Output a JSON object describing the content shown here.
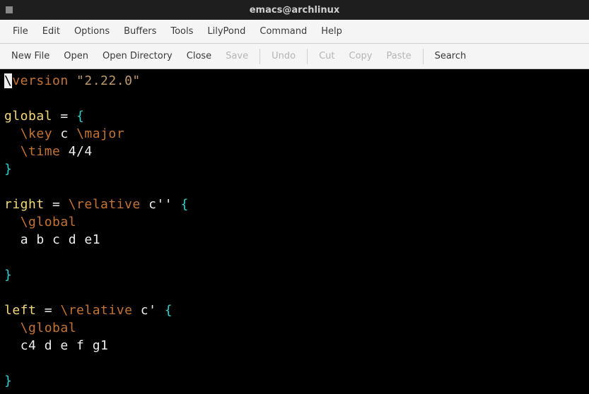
{
  "title": "emacs@archlinux",
  "menubar": [
    "File",
    "Edit",
    "Options",
    "Buffers",
    "Tools",
    "LilyPond",
    "Command",
    "Help"
  ],
  "toolbar": {
    "new_file": "New File",
    "open": "Open",
    "open_directory": "Open Directory",
    "close": "Close",
    "save": "Save",
    "undo": "Undo",
    "cut": "Cut",
    "copy": "Copy",
    "paste": "Paste",
    "search": "Search"
  },
  "code": {
    "l1_bs": "\\",
    "l1_cmd": "version",
    "l1_sp": " ",
    "l1_str": "\"2.22.0\"",
    "l3_var": "global",
    "l3_eq": " = ",
    "l3_brace": "{",
    "l4_ind": "  ",
    "l4_key": "\\key",
    "l4_args": " c ",
    "l4_major": "\\major",
    "l5_ind": "  ",
    "l5_time": "\\time",
    "l5_args": " 4/4",
    "l6_brace": "}",
    "l8_var": "right",
    "l8_eq": " = ",
    "l8_rel": "\\relative",
    "l8_args": " c'' ",
    "l8_brace": "{",
    "l9_ind": "  ",
    "l9_global": "\\global",
    "l10_ind": "  ",
    "l10_notes": "a b c d e1",
    "l12_brace": "}",
    "l14_var": "left",
    "l14_eq": " = ",
    "l14_rel": "\\relative",
    "l14_args": " c' ",
    "l14_brace": "{",
    "l15_ind": "  ",
    "l15_global": "\\global",
    "l16_ind": "  ",
    "l16_notes": "c4 d e f g1",
    "l18_brace": "}"
  }
}
